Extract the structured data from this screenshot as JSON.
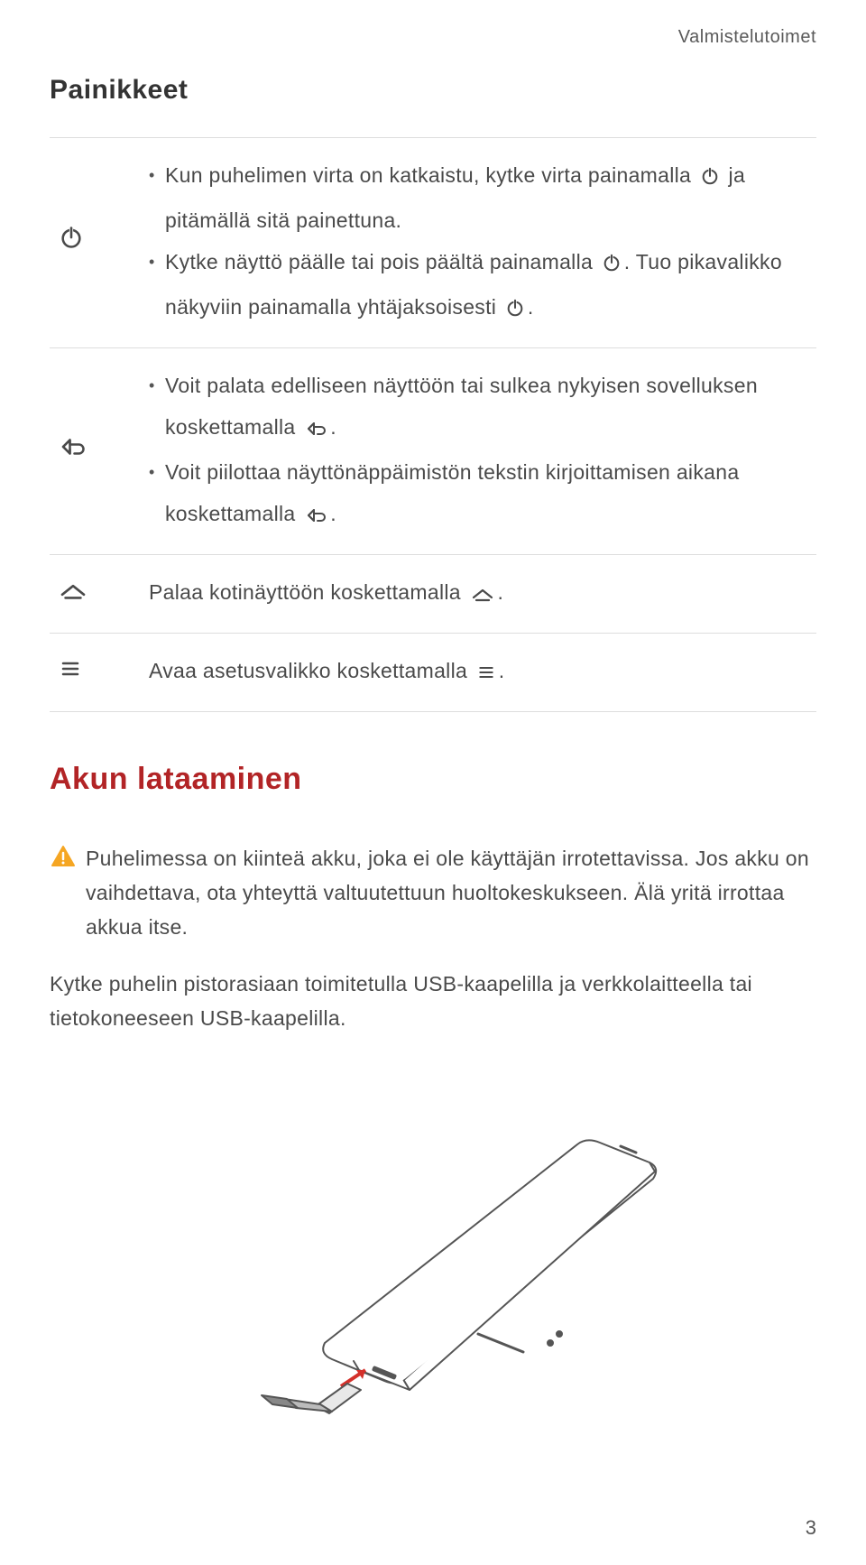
{
  "header": {
    "chapter": "Valmistelutoimet"
  },
  "section1": {
    "title": "Painikkeet",
    "rows": {
      "power": {
        "b1a": "Kun puhelimen virta on katkaistu, kytke virta painamalla ",
        "b1b": " ja pitämällä sitä painettuna.",
        "b2a": "Kytke näyttö päälle tai pois päältä painamalla ",
        "b2b": ". Tuo pikavalikko näkyviin painamalla yhtäjaksoisesti ",
        "b2c": "."
      },
      "back": {
        "b1a": "Voit palata edelliseen näyttöön tai sulkea nykyisen sovelluksen koskettamalla ",
        "b1b": ".",
        "b2a": "Voit piilottaa näyttönäppäimistön tekstin kirjoittamisen aikana koskettamalla ",
        "b2b": "."
      },
      "home": {
        "a": "Palaa kotinäyttöön koskettamalla ",
        "b": "."
      },
      "menu": {
        "a": "Avaa asetusvalikko koskettamalla ",
        "b": "."
      }
    }
  },
  "section2": {
    "title": "Akun lataaminen",
    "warning": "Puhelimessa on kiinteä akku, joka ei ole käyttäjän irrotettavissa. Jos akku on vaihdettava, ota yhteyttä valtuutettuun huoltokeskukseen. Älä yritä irrottaa akkua itse.",
    "para": "Kytke puhelin pistorasiaan toimitetulla USB-kaapelilla ja verkkolaitteella tai tietokoneeseen USB-kaapelilla."
  },
  "page": "3"
}
